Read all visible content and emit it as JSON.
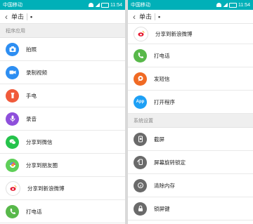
{
  "status": {
    "carrier": "中国移动",
    "time": "11:54"
  },
  "left": {
    "title": "单击",
    "dot": "•",
    "section": "程序应用",
    "items": [
      {
        "label": "拍照",
        "icon": "camera-icon"
      },
      {
        "label": "录制视频",
        "icon": "video-icon"
      },
      {
        "label": "手电",
        "icon": "flashlight-icon"
      },
      {
        "label": "录音",
        "icon": "microphone-icon"
      },
      {
        "label": "分享到微信",
        "icon": "wechat-icon"
      },
      {
        "label": "分享到朋友圈",
        "icon": "moments-icon"
      },
      {
        "label": "分享到新浪微博",
        "icon": "weibo-icon"
      },
      {
        "label": "打电话",
        "icon": "phone-icon"
      }
    ]
  },
  "right": {
    "title": "单击",
    "dot": "•",
    "items_top": [
      {
        "label": "分享到新浪微博",
        "icon": "weibo-icon"
      },
      {
        "label": "打电话",
        "icon": "phone-icon"
      },
      {
        "label": "发短信",
        "icon": "sms-icon"
      },
      {
        "label": "打开程序",
        "icon": "app-icon",
        "badge": "App"
      }
    ],
    "section": "系统设置",
    "items_bottom": [
      {
        "label": "截屏",
        "icon": "screenshot-icon"
      },
      {
        "label": "屏幕旋转锁定",
        "icon": "rotation-lock-icon"
      },
      {
        "label": "清除内存",
        "icon": "clean-memory-icon"
      },
      {
        "label": "锁屏键",
        "icon": "lock-icon"
      }
    ]
  }
}
